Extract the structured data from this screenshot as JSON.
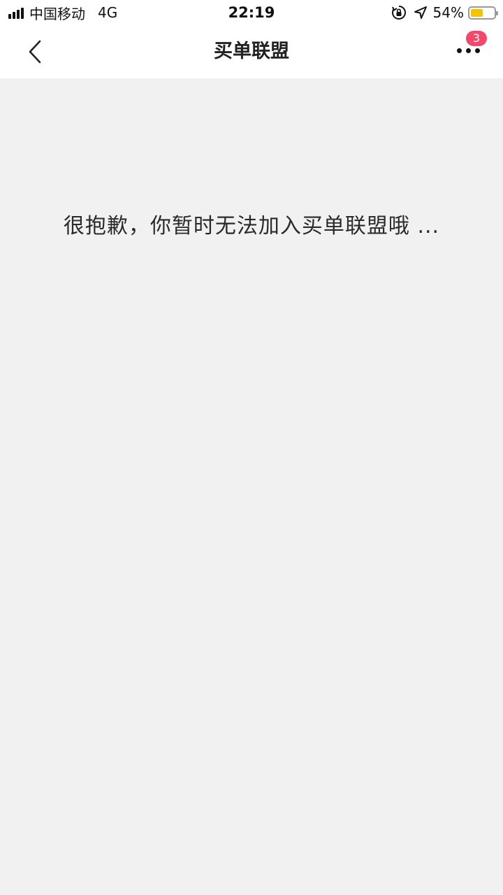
{
  "status_bar": {
    "carrier": "中国移动",
    "network": "4G",
    "time": "22:19",
    "battery_percent": "54%",
    "battery_level": 0.54,
    "battery_color": "#f5c400",
    "icons": [
      "signal-icon",
      "rotation-lock-icon",
      "location-icon",
      "battery-icon"
    ]
  },
  "nav": {
    "title": "买单联盟",
    "back_icon": "chevron-left-icon",
    "more_icon": "more-icon",
    "badge_count": "3",
    "badge_color": "#f4486a"
  },
  "main": {
    "message": "很抱歉，你暂时无法加入买单联盟哦 ..."
  }
}
